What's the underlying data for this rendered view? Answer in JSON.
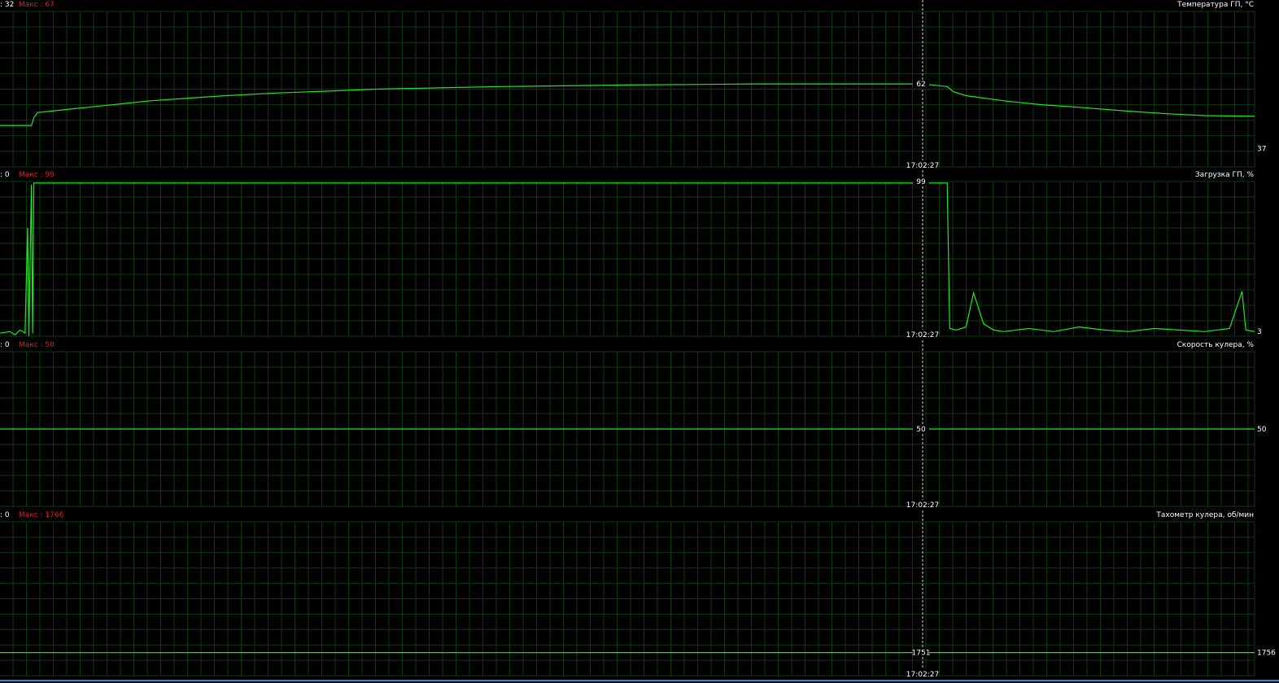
{
  "colors": {
    "background": "#000000",
    "grid": "#0d3a0d",
    "trace": "#1ee81e",
    "label": "#ffffff",
    "max": "#e02020",
    "cursor": "#d8d8a0",
    "separator": "#1a1a1a",
    "bottom_bar": "#1f8fd8"
  },
  "cursor_time": "17:02:27",
  "chart_data": [
    {
      "type": "line",
      "title": "Температура ГП, °C",
      "min_label": ": 32",
      "max_label": "Макс : 67",
      "ylim": [
        30,
        90
      ],
      "cursor_value": "62",
      "current_value": "37",
      "series": [
        {
          "x": [
            0,
            2.5,
            2.7,
            3,
            4,
            6,
            8,
            10,
            12,
            15,
            18,
            22,
            26,
            30,
            35,
            40,
            45,
            50,
            55,
            60,
            65,
            70,
            73.5,
            74.5,
            75.5,
            76,
            77,
            80,
            83,
            86,
            90,
            93,
            96,
            100
          ],
          "y": [
            46,
            46,
            49,
            51,
            51.5,
            52.5,
            53.5,
            54.5,
            55.5,
            56.5,
            57.5,
            58.5,
            59.2,
            60,
            60.5,
            61,
            61.3,
            61.6,
            61.8,
            62,
            62,
            62,
            62,
            61.5,
            61,
            59,
            57.5,
            55.5,
            54,
            53,
            51.5,
            50.5,
            49.8,
            49.5
          ]
        }
      ]
    },
    {
      "type": "line",
      "title": "Загрузка ГП, %",
      "min_label": ": 0",
      "max_label": "Макс : 99",
      "ylim": [
        0,
        100
      ],
      "cursor_value": "99",
      "current_value": "3",
      "series": [
        {
          "x": [
            0,
            0.8,
            1.2,
            1.6,
            2.0,
            2.2,
            2.3,
            2.5,
            2.6,
            2.7,
            2.75,
            74.4,
            75.5,
            75.7,
            76.2,
            77,
            77.6,
            78.4,
            79.2,
            80,
            82,
            84,
            86,
            88,
            90,
            92,
            94,
            96,
            98,
            99,
            99.3,
            100
          ],
          "y": [
            2,
            3,
            1,
            4,
            2,
            70,
            0,
            98,
            2,
            99,
            99,
            99,
            99,
            5,
            4,
            6,
            28,
            8,
            4,
            3,
            5,
            3,
            6,
            4,
            3,
            5,
            4,
            3,
            5,
            29,
            4,
            3
          ]
        }
      ]
    },
    {
      "type": "line",
      "title": "Скорость кулера, %",
      "min_label": ": 0",
      "max_label": "Макс : 50",
      "ylim": [
        0,
        100
      ],
      "cursor_value": "50",
      "current_value": "50",
      "series": [
        {
          "x": [
            0,
            100
          ],
          "y": [
            50,
            50
          ]
        }
      ]
    },
    {
      "type": "line",
      "title": "Тахометр кулера, об/мин",
      "min_label": ": 0",
      "max_label": "Макс : 1766",
      "ylim": [
        0,
        2000
      ],
      "cursor_value": "1751",
      "current_value": "1756",
      "series": [
        {
          "x": [
            0,
            10,
            20,
            30,
            40,
            50,
            60,
            70,
            73.5,
            80,
            90,
            100
          ],
          "y": [
            300,
            299,
            301,
            300,
            299,
            301,
            300,
            299,
            300,
            301,
            300,
            300
          ]
        }
      ]
    }
  ]
}
